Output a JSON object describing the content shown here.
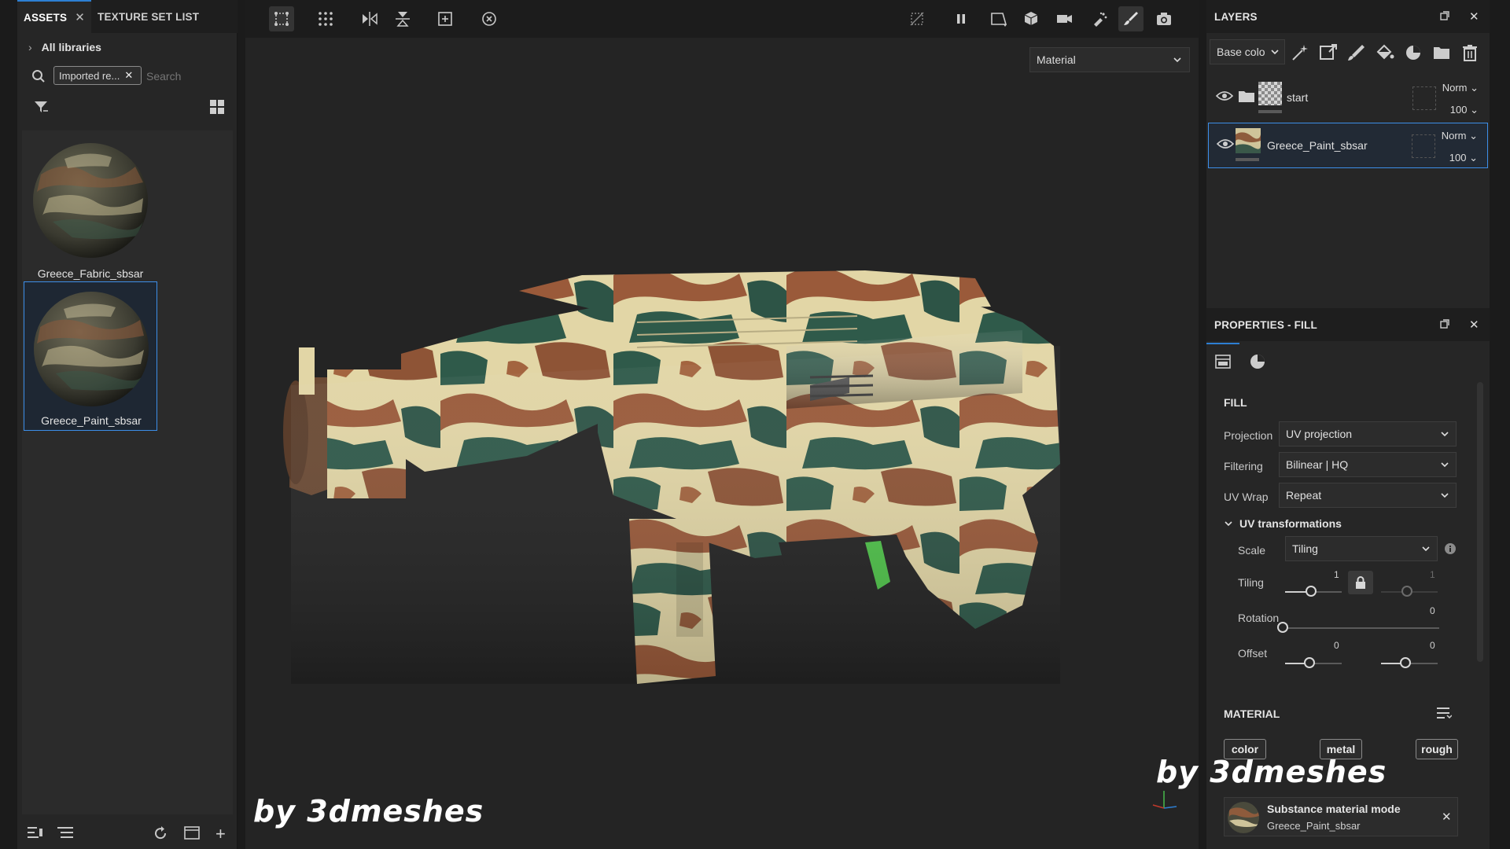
{
  "assets": {
    "tabs": [
      {
        "label": "ASSETS"
      },
      {
        "label": "TEXTURE SET LIST"
      }
    ],
    "breadcrumb": "All libraries",
    "filter_chip": "Imported re...",
    "search_placeholder": "Search",
    "items": [
      {
        "label": "Greece_Fabric_sbsar"
      },
      {
        "label": "Greece_Paint_sbsar"
      }
    ]
  },
  "viewport": {
    "material_select": "Material",
    "watermark_left": "by 3dmeshes",
    "watermark_right": "by 3dmeshes"
  },
  "layers": {
    "title": "LAYERS",
    "channel_select": "Base colo",
    "rows": [
      {
        "name": "start",
        "blend": "Norm",
        "opacity": "100"
      },
      {
        "name": "Greece_Paint_sbsar",
        "blend": "Norm",
        "opacity": "100"
      }
    ]
  },
  "properties": {
    "title": "PROPERTIES - FILL",
    "fill_section": "FILL",
    "projection_label": "Projection",
    "projection_value": "UV projection",
    "filtering_label": "Filtering",
    "filtering_value": "Bilinear | HQ",
    "uvwrap_label": "UV Wrap",
    "uvwrap_value": "Repeat",
    "uv_transform_title": "UV transformations",
    "scale_label": "Scale",
    "scale_value": "Tiling",
    "tiling_label": "Tiling",
    "tiling_u": "1",
    "tiling_v": "1",
    "rotation_label": "Rotation",
    "rotation_value": "0",
    "offset_label": "Offset",
    "offset_u": "0",
    "offset_v": "0",
    "material_section": "MATERIAL",
    "channels": [
      "color",
      "metal",
      "rough"
    ],
    "substance_title": "Substance material mode",
    "substance_name": "Greece_Paint_sbsar"
  },
  "colors": {
    "accent": "#3d8ee8",
    "panel_bg": "#262626",
    "viewport_bg": "#242424"
  }
}
